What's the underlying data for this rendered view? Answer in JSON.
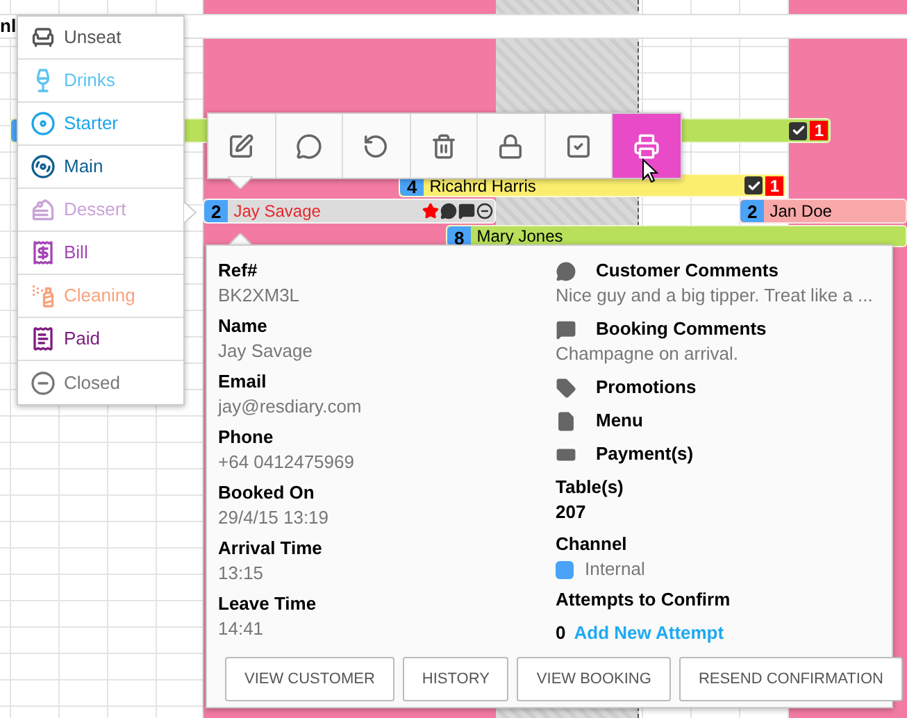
{
  "header_text": "nl",
  "bookings": [
    {
      "color": "#b8e05a",
      "confirmed": true,
      "alert": "1"
    },
    {
      "covers": "4",
      "name": "Ricahrd Harris",
      "color": "#fbee6e",
      "confirmed": true,
      "alert": "1"
    },
    {
      "covers": "2",
      "name": "Jay Savage",
      "color": "#dcdcdc",
      "late": true,
      "confirmed": false,
      "markers": [
        {
          "kind": "vip"
        },
        {
          "kind": "customer-comment"
        },
        {
          "kind": "booking-comment"
        },
        {
          "kind": "closed"
        }
      ]
    },
    {
      "covers": "2",
      "name": "Jan Doe",
      "color": "#f8a8a8",
      "confirmed": false
    },
    {
      "covers": "8",
      "name": "Mary Jones",
      "color": "#b8e05a",
      "confirmed": false
    }
  ],
  "context_menu": [
    {
      "kind": "unseat",
      "label": "Unseat",
      "color": "#555555"
    },
    {
      "kind": "drinks",
      "label": "Drinks",
      "color": "#5cc3f2"
    },
    {
      "kind": "starter",
      "label": "Starter",
      "color": "#1ba5ea"
    },
    {
      "kind": "main",
      "label": "Main",
      "color": "#0f5f91"
    },
    {
      "kind": "dessert",
      "label": "Dessert",
      "color": "#c9a3d8"
    },
    {
      "kind": "bill",
      "label": "Bill",
      "color": "#a545b5"
    },
    {
      "kind": "cleaning",
      "label": "Cleaning",
      "color": "#f7a27c"
    },
    {
      "kind": "paid",
      "label": "Paid",
      "color": "#7d1c80"
    },
    {
      "kind": "closed",
      "label": "Closed",
      "color": "#777777"
    }
  ],
  "toolbar": [
    {
      "kind": "edit",
      "selected": false
    },
    {
      "kind": "review",
      "selected": false
    },
    {
      "kind": "undo",
      "selected": false
    },
    {
      "kind": "delete",
      "selected": false
    },
    {
      "kind": "lock",
      "selected": false
    },
    {
      "kind": "confirm",
      "selected": false
    },
    {
      "kind": "print",
      "selected": true
    }
  ],
  "details": {
    "left": [
      {
        "label": "Ref#",
        "value": "BK2XM3L"
      },
      {
        "label": "Name",
        "value": "Jay Savage"
      },
      {
        "label": "Email",
        "value": "jay@resdiary.com"
      },
      {
        "label": "Phone",
        "value": "+64 0412475969"
      },
      {
        "label": "Booked On",
        "value": "29/4/15 13:19"
      },
      {
        "label": "Arrival Time",
        "value": "13:15"
      },
      {
        "label": "Leave Time",
        "value": "14:41"
      }
    ],
    "right": [
      {
        "kind": "customer-comment",
        "label": "Customer Comments",
        "value": "Nice guy and a big tipper. Treat like a ..."
      },
      {
        "kind": "booking-comment",
        "label": "Booking Comments",
        "value": "Champagne on arrival."
      },
      {
        "kind": "tag",
        "label": "Promotions"
      },
      {
        "kind": "document",
        "label": "Menu"
      },
      {
        "kind": "money",
        "label": "Payment(s)"
      }
    ],
    "tables": {
      "label": "Table(s)",
      "value": "207"
    },
    "channel": {
      "label": "Channel",
      "value": "Internal",
      "color": "#4aa3f7"
    },
    "attempts": {
      "label": "Attempts to Confirm",
      "count": "0",
      "link": "Add New Attempt"
    },
    "buttons": [
      "VIEW CUSTOMER",
      "HISTORY",
      "VIEW BOOKING",
      "RESEND CONFIRMATION"
    ]
  }
}
